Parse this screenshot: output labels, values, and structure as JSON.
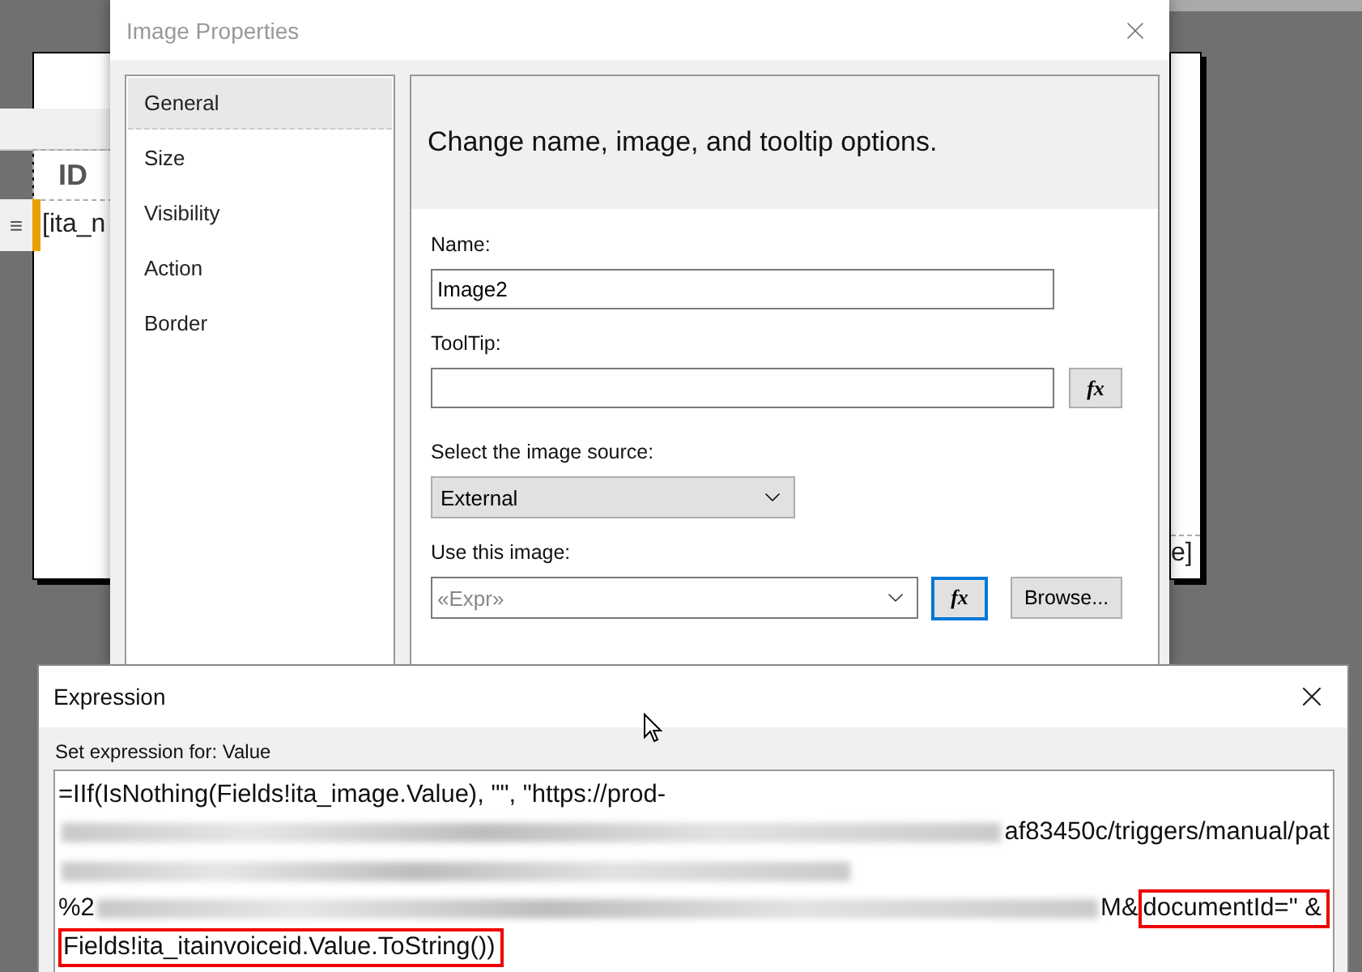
{
  "report": {
    "header_cell": "ID",
    "row_handle": "≡",
    "data_cell": "[ita_n",
    "right_cell": "e]"
  },
  "image_properties": {
    "title": "Image Properties",
    "active": false,
    "pages": [
      {
        "label": "General",
        "selected": true
      },
      {
        "label": "Size",
        "selected": false
      },
      {
        "label": "Visibility",
        "selected": false
      },
      {
        "label": "Action",
        "selected": false
      },
      {
        "label": "Border",
        "selected": false
      }
    ],
    "heading": "Change name, image, and tooltip options.",
    "name": {
      "label": "Name:",
      "value": "Image2"
    },
    "tooltip": {
      "label": "ToolTip:",
      "fx": {
        "label": "fx",
        "focused": false
      }
    },
    "image_source": {
      "label": "Select the image source:",
      "value": "External"
    },
    "use_image": {
      "label": "Use this image:",
      "placeholder": "«Expr»",
      "fx": {
        "label": "fx",
        "focused": true
      },
      "browse": "Browse..."
    }
  },
  "expression": {
    "title": "Expression",
    "prompt": "Set expression for: Value",
    "lines": [
      [
        {
          "kind": "text",
          "text": "=IIf(IsNothing(Fields!ita_image.Value), \"\", \"https://prod-",
          "highlighted": false
        }
      ],
      [
        {
          "kind": "blurred"
        },
        {
          "kind": "text",
          "text": "af83450c/triggers/manual/pat",
          "highlighted": false
        }
      ],
      [
        {
          "kind": "blurred"
        }
      ],
      [
        {
          "kind": "text",
          "text": "%2",
          "highlighted": false
        },
        {
          "kind": "blurred"
        },
        {
          "kind": "text",
          "text": "M&",
          "highlighted": false
        },
        {
          "kind": "text",
          "text": "documentId=\" &",
          "highlighted": true
        }
      ],
      [
        {
          "kind": "text",
          "text": "Fields!ita_itainvoiceid.Value.ToString())",
          "highlighted": true
        }
      ]
    ]
  }
}
